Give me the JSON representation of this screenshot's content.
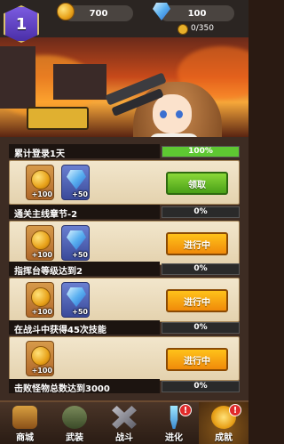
{
  "header": {
    "level": "1",
    "coins": "700",
    "gems": "100",
    "xp": "0/350"
  },
  "tasks": [
    {
      "title": "累计登录1天",
      "progress": "100%",
      "progress_fraction": 1.0,
      "rewards": [
        "+100",
        "+50"
      ],
      "action": "领取",
      "state": "claim"
    },
    {
      "title": "通关主线章节-2",
      "progress": "0%",
      "progress_fraction": 0,
      "rewards": [
        "+100",
        "+50"
      ],
      "action": "进行中",
      "state": "progressing"
    },
    {
      "title": "指挥台等级达到2",
      "progress": "0%",
      "progress_fraction": 0,
      "rewards": [
        "+100",
        "+50"
      ],
      "action": "进行中",
      "state": "progressing"
    },
    {
      "title": "在战斗中获得45次技能",
      "progress": "0%",
      "progress_fraction": 0,
      "rewards": [
        "+100"
      ],
      "action": "进行中",
      "state": "progressing"
    },
    {
      "title": "击败怪物总数达到3000",
      "progress": "0%",
      "progress_fraction": 0
    }
  ],
  "nav": [
    {
      "label": "商城",
      "icon": "shop-icon",
      "badge": ""
    },
    {
      "label": "武装",
      "icon": "soldier-icon",
      "badge": ""
    },
    {
      "label": "战斗",
      "icon": "crossed-guns-icon",
      "badge": ""
    },
    {
      "label": "进化",
      "icon": "syringe-icon",
      "badge": "!"
    },
    {
      "label": "成就",
      "icon": "achievement-icon",
      "badge": "!"
    }
  ]
}
